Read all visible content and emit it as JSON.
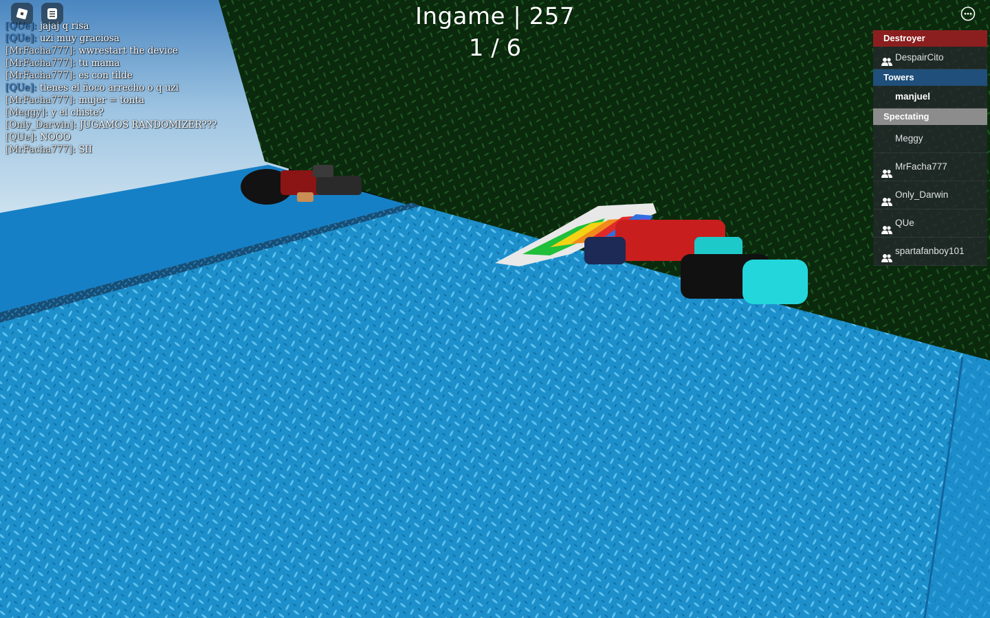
{
  "topbar": {
    "roblox_icon": "roblox-logo-icon",
    "chat_icon": "chat-icon",
    "menu_icon": "more-options-icon"
  },
  "status": {
    "title": "Ingame | 257",
    "count": "1 / 6"
  },
  "chat": {
    "messages": [
      {
        "who": "[QUe]:",
        "text": "jajaj q risa",
        "blue": true
      },
      {
        "who": "[QUe]:",
        "text": "uzi muy graciosa",
        "blue": true
      },
      {
        "who": "[MrFacha777]:",
        "text": "wwrestart the device",
        "blue": false
      },
      {
        "who": "[MrFacha777]:",
        "text": "tu mama",
        "blue": false
      },
      {
        "who": "[MrFacha777]:",
        "text": "es con tilde",
        "blue": false
      },
      {
        "who": "[QUe]:",
        "text": "tienes el ñoco arrecho o q uzi",
        "blue": true
      },
      {
        "who": "[MrFacha777]:",
        "text": "mujer = tonta",
        "blue": false
      },
      {
        "who": "[Meggy]:",
        "text": "y el chiste?",
        "blue": false
      },
      {
        "who": "[Only_Darwin]:",
        "text": "JUGAMOS RANDOMIZER???",
        "blue": false
      },
      {
        "who": "[QUe]:",
        "text": "NOOO",
        "blue": false
      },
      {
        "who": "[MrFacha777]:",
        "text": "SII",
        "blue": false
      }
    ]
  },
  "playerlist": {
    "teams": [
      {
        "name": "Destroyer",
        "color": "#8b1f1f",
        "players": [
          {
            "name": "DespairCito",
            "friend": true
          }
        ]
      },
      {
        "name": "Towers",
        "color": "#1f4f7a",
        "players": [
          {
            "name": "manjuel",
            "friend": false,
            "bold": true
          }
        ]
      },
      {
        "name": "Spectating",
        "color": "#8c8c8c",
        "players": [
          {
            "name": "Meggy",
            "friend": false
          },
          {
            "name": "MrFacha777",
            "friend": true
          },
          {
            "name": "Only_Darwin",
            "friend": true
          },
          {
            "name": "QUe",
            "friend": true
          },
          {
            "name": "spartafanboy101",
            "friend": true
          }
        ]
      }
    ],
    "friend_icon": "friends-icon"
  }
}
